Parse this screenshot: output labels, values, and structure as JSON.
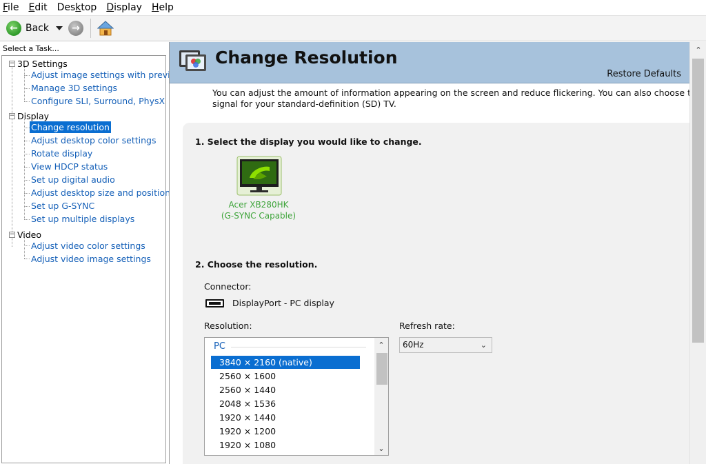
{
  "menu": [
    "File",
    "Edit",
    "Desktop",
    "Display",
    "Help"
  ],
  "menu_accel": [
    "F",
    "E",
    "k",
    "D",
    "H"
  ],
  "toolbar": {
    "back_label": "Back"
  },
  "left": {
    "task_label": "Select a Task...",
    "groups": [
      {
        "label": "3D Settings",
        "items": [
          "Adjust image settings with preview",
          "Manage 3D settings",
          "Configure SLI, Surround, PhysX"
        ]
      },
      {
        "label": "Display",
        "items": [
          "Change resolution",
          "Adjust desktop color settings",
          "Rotate display",
          "View HDCP status",
          "Set up digital audio",
          "Adjust desktop size and position",
          "Set up G-SYNC",
          "Set up multiple displays"
        ]
      },
      {
        "label": "Video",
        "items": [
          "Adjust video color settings",
          "Adjust video image settings"
        ]
      }
    ],
    "selected_item": "Change resolution"
  },
  "header": {
    "title": "Change Resolution",
    "restore_defaults": "Restore Defaults"
  },
  "intro": {
    "line1": "You can adjust the amount of information appearing on the screen and reduce flickering. You can also choose the high-defir",
    "line2": "signal for your standard-definition (SD) TV."
  },
  "step1": {
    "title": "1. Select the display you would like to change.",
    "display_name": "Acer XB280HK",
    "display_capability": "(G-SYNC Capable)"
  },
  "step2": {
    "title": "2. Choose the resolution.",
    "connector_label": "Connector:",
    "connector_value": "DisplayPort - PC display",
    "resolution_label": "Resolution:",
    "refresh_label": "Refresh rate:",
    "refresh_value": "60Hz",
    "res_group": "PC",
    "resolutions": [
      "3840 × 2160 (native)",
      "2560 × 1600",
      "2560 × 1440",
      "2048 × 1536",
      "1920 × 1440",
      "1920 × 1200",
      "1920 × 1080"
    ],
    "selected_resolution": "3840 × 2160 (native)"
  },
  "colors": {
    "accent": "#0a6ed1",
    "link": "#1560b8",
    "nvidia_green": "#76b900",
    "header_band": "#a7c2dc"
  }
}
